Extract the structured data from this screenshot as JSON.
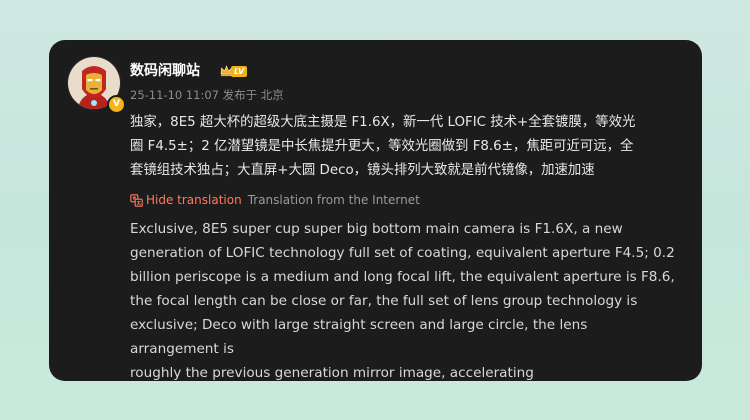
{
  "post": {
    "author_name": "数码闲聊站",
    "level_badge": "LV",
    "timestamp": "25-11-10 11:07",
    "location": "发布于 北京",
    "content_lines": [
      "独家，8E5 超大杯的超级大底主摄是 F1.6X，新一代 LOFIC 技术+全套镀膜，等效光",
      "圈 F4.5±；2 亿潜望镜是中长焦提升更大，等效光圈做到 F8.6±，焦距可近可远，全",
      "套镜组技术独占；大直屏+大圆 Deco，镜头排列大致就是前代镜像，加速加速"
    ],
    "hide_translation_label": "Hide translation",
    "translation_source": "Translation from the Internet",
    "translation_lines": [
      "Exclusive, 8E5 super cup super big bottom main camera is F1.6X, a new",
      "generation of LOFIC technology full set of coating, equivalent aperture F4.5; 0.2",
      "billion periscope is a medium and long focal lift, the equivalent aperture is F8.6,",
      "the focal length can be close or far, the full set of lens group technology is",
      "exclusive; Deco with large straight screen and large circle, the lens arrangement is",
      "roughly the previous generation mirror image, accelerating"
    ],
    "verified_mark": "V"
  },
  "icons": {
    "avatar": "iron-man-avatar-icon",
    "verified": "verified-badge-icon",
    "crown": "crown-icon",
    "translate": "translate-icon"
  },
  "colors": {
    "card_background": "#1c1c1c",
    "link_accent": "#ff7a5c",
    "badge_gold": "#f0b21c"
  }
}
